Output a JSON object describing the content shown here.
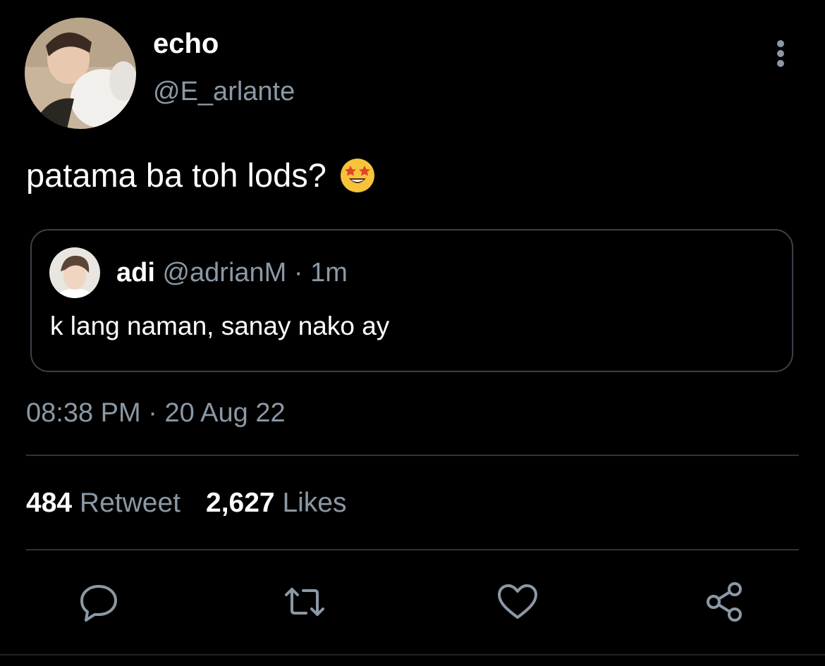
{
  "author": {
    "display_name": "echo",
    "handle": "@E_arlante",
    "avatar_icon": "profile-photo"
  },
  "more_icon": "more-vertical-icon",
  "tweet": {
    "text": "patama ba toh lods?",
    "emoji": "star-struck-emoji"
  },
  "quote": {
    "display_name": "adi",
    "handle": "@adrianM",
    "separator": "·",
    "time": "1m",
    "text": "k lang naman, sanay nako ay",
    "avatar_icon": "profile-photo"
  },
  "timestamp": {
    "time": "08:38 PM",
    "separator": "·",
    "date": "20 Aug 22"
  },
  "stats": {
    "retweets_count": "484",
    "retweets_label": "Retweet",
    "likes_count": "2,627",
    "likes_label": "Likes"
  },
  "actions": {
    "reply_icon": "reply-icon",
    "retweet_icon": "retweet-icon",
    "like_icon": "heart-icon",
    "share_icon": "share-icon"
  },
  "colors": {
    "background": "#000000",
    "primary_text": "#ffffff",
    "secondary_text": "#8b98a5",
    "border": "#3b4149",
    "icon": "#8b98a5"
  }
}
